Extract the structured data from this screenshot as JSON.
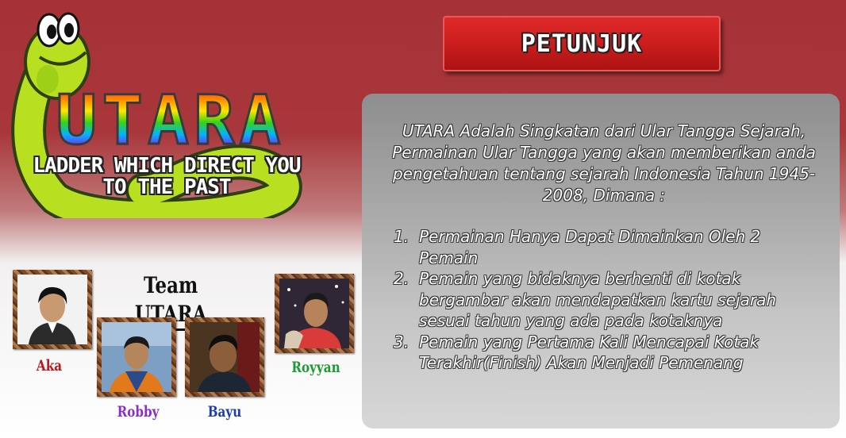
{
  "logo": {
    "title": "UTARA",
    "subtitle_line1": "LADDER WHICH DIRECT YOU",
    "subtitle_line2": "TO THE PAST"
  },
  "petunjuk_button": {
    "label": "PETUNJUK"
  },
  "info_panel": {
    "intro": "UTARA Adalah Singkatan dari Ular Tangga Sejarah, Permainan Ular Tangga yang akan memberikan anda pengetahuan tentang sejarah Indonesia Tahun 1945-2008, Dimana :",
    "rules": [
      {
        "num": "1.",
        "text": "Permainan Hanya Dapat Dimainkan Oleh 2 Pemain"
      },
      {
        "num": "2.",
        "text": "Pemain yang bidaknya berhenti di kotak bergambar akan mendapatkan kartu sejarah sesuai tahun yang ada pada kotaknya"
      },
      {
        "num": "3.",
        "text": "Pemain yang Pertama Kali Mencapai Kotak Terakhir(Finish) Akan Menjadi Pemenang"
      }
    ]
  },
  "team": {
    "title": "Team UTARA",
    "members": [
      {
        "name": "Aka",
        "color": "#c0161c"
      },
      {
        "name": "Robby",
        "color": "#8b2fc9"
      },
      {
        "name": "Bayu",
        "color": "#1f3fa8"
      },
      {
        "name": "Royyan",
        "color": "#1e9a35"
      }
    ]
  },
  "colors": {
    "background_top": "#a63236",
    "button_red": "#c91c1c",
    "panel_grey": "#a9a9a9"
  }
}
